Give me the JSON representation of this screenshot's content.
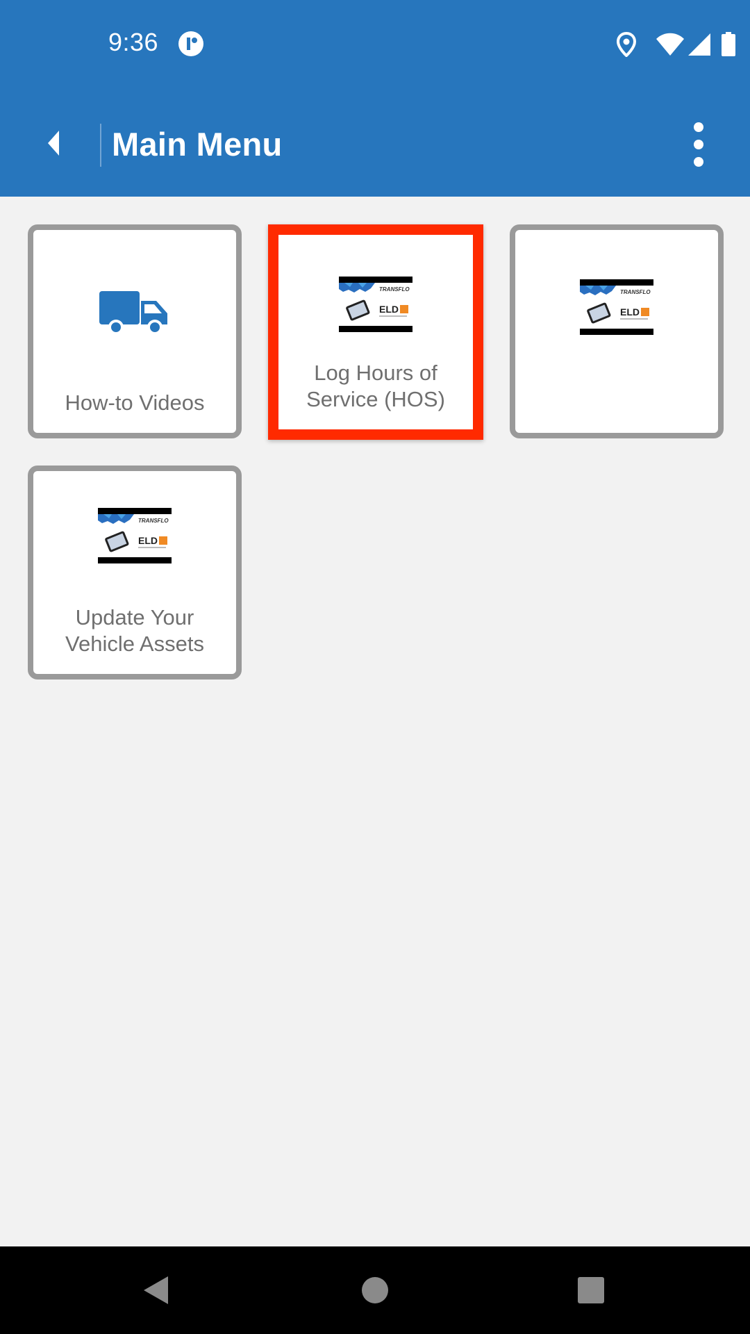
{
  "status_bar": {
    "time": "9:36",
    "icons": [
      "app-notification-icon",
      "location-icon",
      "wifi-icon",
      "cell-signal-icon",
      "battery-icon"
    ]
  },
  "app_bar": {
    "title": "Main Menu",
    "back_icon": "chevron-left-icon",
    "menu_icon": "more-vert-icon",
    "color": "#2776bd"
  },
  "tiles": [
    {
      "label": "How-to Videos",
      "icon": "truck-icon",
      "selected": false
    },
    {
      "label": "Log Hours of\nService (HOS)",
      "icon": "transflo-eld-logo",
      "selected": true
    },
    {
      "label": "",
      "icon": "transflo-eld-logo",
      "selected": false
    },
    {
      "label": "Update Your\nVehicle Assets",
      "icon": "transflo-eld-logo",
      "selected": false
    }
  ],
  "logo": {
    "brand": "TRANSFLO",
    "product": "ELD"
  },
  "highlight_color": "#ff2a00",
  "nav_bar": {
    "buttons": [
      "back",
      "home",
      "recents"
    ]
  }
}
